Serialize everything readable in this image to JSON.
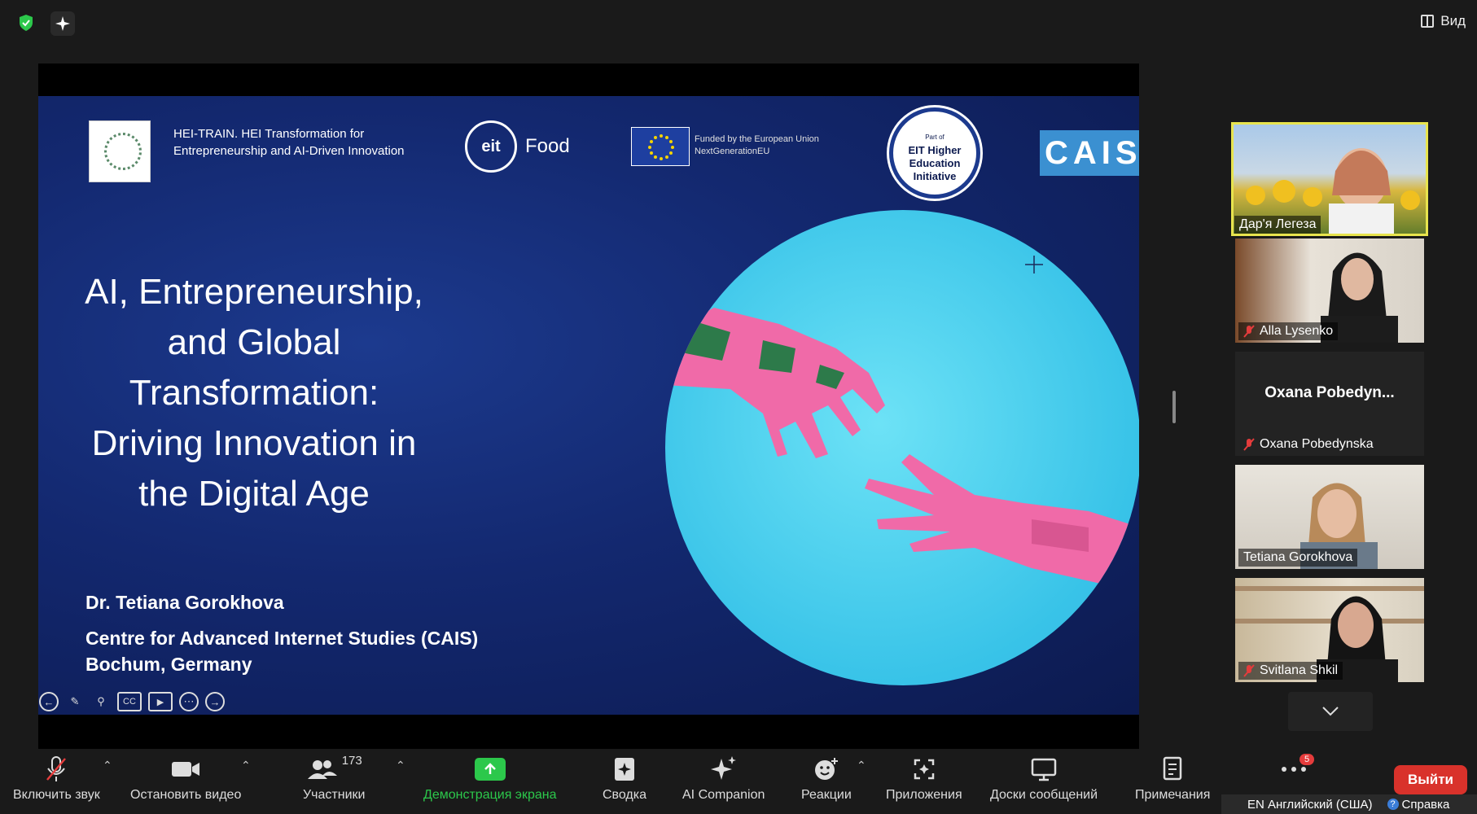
{
  "topbar": {
    "view_label": "Вид",
    "icons": [
      "shield-icon",
      "sparkle-icon",
      "view-icon"
    ]
  },
  "slide": {
    "hei_text": "HEI-TRAIN. HEI Transformation for Entrepreneurship and AI-Driven Innovation",
    "eit_logo": "eit",
    "eit_food": "Food",
    "eu_text": "Funded by the European Union NextGenerationEU",
    "eit_he_small": "Part of",
    "eit_he_text": "EIT Higher Education Initiative",
    "cais_logo": "CAIS",
    "title": "AI, Entrepreneurship, and Global Transformation: Driving Innovation in the Digital Age",
    "author": "Dr. Tetiana Gorokhova",
    "affiliation": "Centre for Advanced Internet Studies (CAIS)",
    "location": "Bochum, Germany",
    "controls": [
      "back-icon",
      "pen-icon",
      "zoom-icon",
      "cc-icon",
      "camera-icon",
      "more-icon",
      "forward-icon"
    ],
    "cc_label": "CC"
  },
  "participants": [
    {
      "name": "Дар'я Легеза",
      "muted": false,
      "active": true,
      "video": true
    },
    {
      "name": "Alla Lysenko",
      "muted": true,
      "active": false,
      "video": true
    },
    {
      "name": "Oxana Pobedynska",
      "display": "Oxana  Pobedyn...",
      "muted": true,
      "active": false,
      "video": false
    },
    {
      "name": "Tetiana Gorokhova",
      "muted": false,
      "active": false,
      "video": true
    },
    {
      "name": "Svitlana Shkil",
      "muted": true,
      "active": false,
      "video": true
    }
  ],
  "toolbar": {
    "mute": "Включить звук",
    "video": "Остановить видео",
    "participants": "Участники",
    "participants_count": "173",
    "share": "Демонстрация экрана",
    "summary": "Сводка",
    "ai": "AI Companion",
    "reactions": "Реакции",
    "apps": "Приложения",
    "whiteboards": "Доски сообщений",
    "notes": "Примечания",
    "more_badge": "5",
    "leave": "Выйти"
  },
  "taskbar": {
    "lang": "EN Английский (США)",
    "help": "Справка"
  },
  "colors": {
    "share_green": "#2cc84b",
    "leave_red": "#d9322b",
    "active_speaker": "#e8e44e",
    "slide_blue": "#13286f",
    "circle_cyan": "#38c3e8"
  }
}
